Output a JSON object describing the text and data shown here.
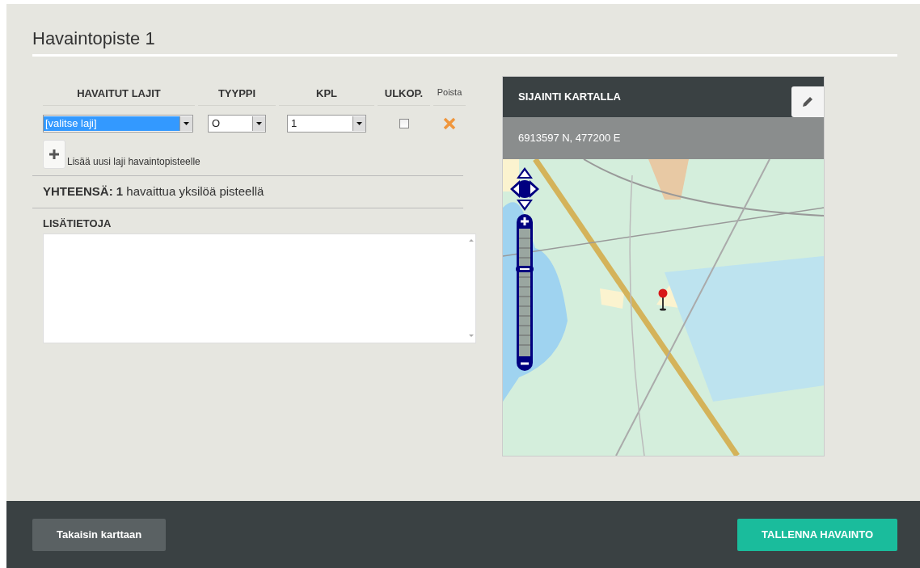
{
  "title": "Havaintopiste 1",
  "species_table": {
    "columns": [
      "HAVAITUT LAJIT",
      "TYYPPI",
      "KPL",
      "ULKOP.",
      "Poista"
    ],
    "rows": [
      {
        "species": "[valitse laji]",
        "species_focused": true,
        "type": "O",
        "count": "1",
        "outside_checked": false
      }
    ]
  },
  "add_species": {
    "label": "Lisää uusi laji havaintopisteelle"
  },
  "total": "**YHTEENSÄ: 1** havaittua yksilöä pisteellä",
  "notes": {
    "label": "LISÄTIETOJA"
  },
  "map_panel": {
    "title": "SIJAINTI KARTALLA",
    "coordinates": "6913597 N, 477200 E"
  },
  "footer": {
    "back_button": "Takaisin karttaan",
    "save_button": "TALLENNA HAVAINTO"
  }
}
